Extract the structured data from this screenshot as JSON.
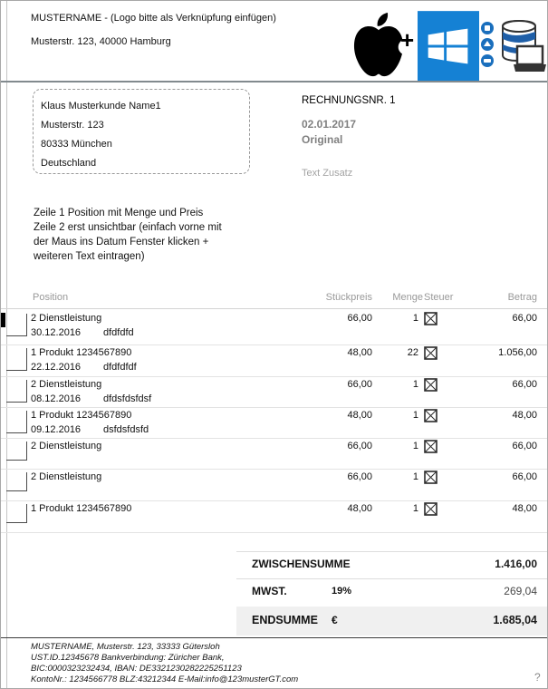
{
  "header": {
    "company_line": "MUSTERNAME -  (Logo bitte als Verknüpfung einfügen)",
    "address_line": "Musterstr. 123, 40000 Hamburg",
    "plus_sign": "+"
  },
  "recipient": {
    "lines": [
      "Klaus Musterkunde Name1",
      "Musterstr. 123",
      "80333 München",
      "Deutschland"
    ]
  },
  "invoice": {
    "number_label": "RECHNUNGSNR. 1",
    "date": "02.01.2017",
    "doc_type": "Original",
    "extra_text": "Text Zusatz"
  },
  "note": {
    "line1": "Zeile 1 Position mit Menge und Preis",
    "line2": "Zeile 2 erst unsichtbar (einfach vorne mit",
    "line3": "der Maus ins Datum Fenster klicken +",
    "line4": "weiteren Text eintragen)"
  },
  "table": {
    "headers": {
      "position": "Position",
      "unit_price": "Stückpreis",
      "qty": "Menge",
      "tax": "Steuer",
      "amount": "Betrag"
    },
    "rows": [
      {
        "name": "2 Dienstleistung",
        "date": "30.12.2016",
        "note": "dfdfdfd",
        "unit_price": "66,00",
        "qty": "1",
        "amount": "66,00"
      },
      {
        "name": "1 Produkt 1234567890",
        "date": "22.12.2016",
        "note": "dfdfdfdf",
        "unit_price": "48,00",
        "qty": "22",
        "amount": "1.056,00"
      },
      {
        "name": "2 Dienstleistung",
        "date": "08.12.2016",
        "note": "dfdsfdsfdsf",
        "unit_price": "66,00",
        "qty": "1",
        "amount": "66,00"
      },
      {
        "name": "1 Produkt 1234567890",
        "date": "09.12.2016",
        "note": "dsfdsfdsfd",
        "unit_price": "48,00",
        "qty": "1",
        "amount": "48,00"
      },
      {
        "name": "2 Dienstleistung",
        "unit_price": "66,00",
        "qty": "1",
        "amount": "66,00"
      },
      {
        "name": "2 Dienstleistung",
        "unit_price": "66,00",
        "qty": "1",
        "amount": "66,00"
      },
      {
        "name": "1 Produkt 1234567890",
        "unit_price": "48,00",
        "qty": "1",
        "amount": "48,00"
      }
    ]
  },
  "summary": {
    "subtotal_label": "ZWISCHENSUMME",
    "subtotal": "1.416,00",
    "vat_label": "MWST.",
    "vat_rate": "19%",
    "vat_amount": "269,04",
    "total_label": "ENDSUMME",
    "currency": "€",
    "total": "1.685,04"
  },
  "footer": {
    "lines": [
      "MUSTERNAME, Musterstr. 123, 33333 Gütersloh",
      "UST.ID.12345678 Bankverbindung: Züricher Bank,",
      "BIC:0000323232434, IBAN: DE3321230282225251123",
      "KontoNr.: 1234566778 BLZ:43212344 E-Mail:info@123musterGT.com"
    ],
    "help": "?"
  },
  "colors": {
    "windows_blue": "#1581d4",
    "icon_blue": "#1a6fbd",
    "rule_gray": "#828a8e",
    "total_bg": "#f0f0f0"
  }
}
